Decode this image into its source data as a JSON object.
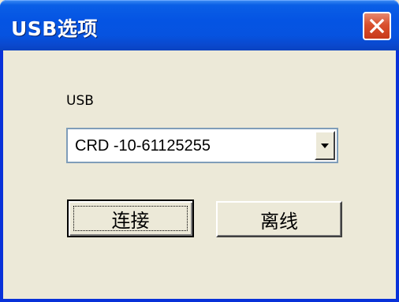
{
  "window": {
    "title": "USB选项"
  },
  "form": {
    "usb_label": "USB",
    "usb_device": {
      "selected": "CRD -10-61125255"
    }
  },
  "buttons": {
    "connect_label": "连接",
    "offline_label": "离线"
  },
  "icons": {
    "close": "close-icon",
    "dropdown": "chevron-down-icon"
  },
  "colors": {
    "titlebar": "#0554e3",
    "window_border": "#0831d9",
    "client_bg": "#ece9d8",
    "close_button": "#d9502d"
  }
}
